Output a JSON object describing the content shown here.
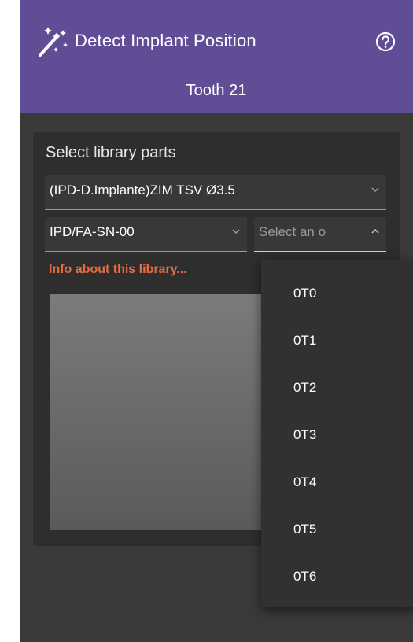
{
  "header": {
    "title": "Detect Implant Position",
    "subtitle": "Tooth 21",
    "icons": {
      "wand": "magic-wand-icon",
      "help": "help-circle-icon"
    }
  },
  "library": {
    "section_label": "Select library parts",
    "implant_select": {
      "value": "(IPD-D.Implante)ZIM TSV Ø3.5"
    },
    "part_select": {
      "value": "IPD/FA-SN-00"
    },
    "option_select": {
      "placeholder": "Select an o"
    },
    "info_link": "Info about this library..."
  },
  "dropdown": {
    "options": [
      "0T0",
      "0T1",
      "0T2",
      "0T3",
      "0T4",
      "0T5",
      "0T6"
    ]
  },
  "colors": {
    "header_bg": "#614d96",
    "panel_bg": "#3a3a3a",
    "card_bg": "#2e2e2e",
    "link": "#e86c3f"
  }
}
